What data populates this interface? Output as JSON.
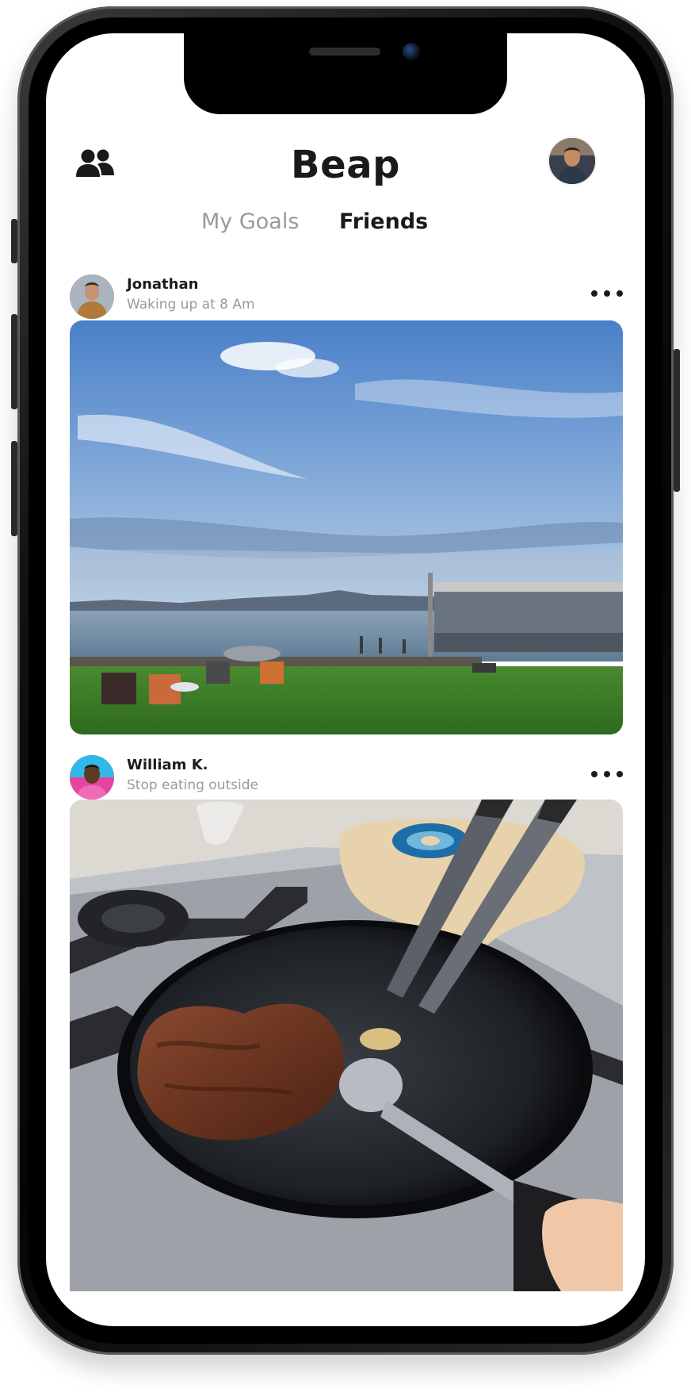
{
  "app": {
    "title": "Beap"
  },
  "header": {
    "left_icon": "friends-group-icon",
    "right_icon": "profile-avatar"
  },
  "tabs": [
    {
      "label": "My Goals",
      "active": false
    },
    {
      "label": "Friends",
      "active": true
    }
  ],
  "posts": [
    {
      "author": "Jonathan",
      "goal": "Waking up at 8 Am",
      "menu_icon": "more-horizontal-icon",
      "image": "lakeside-photo"
    },
    {
      "author": "William K.",
      "goal": "Stop eating outside",
      "menu_icon": "more-horizontal-icon",
      "image": "steak-pan-photo"
    }
  ],
  "colors": {
    "text_primary": "#1a1a1a",
    "text_secondary": "#9a9a9a",
    "background": "#ffffff"
  }
}
